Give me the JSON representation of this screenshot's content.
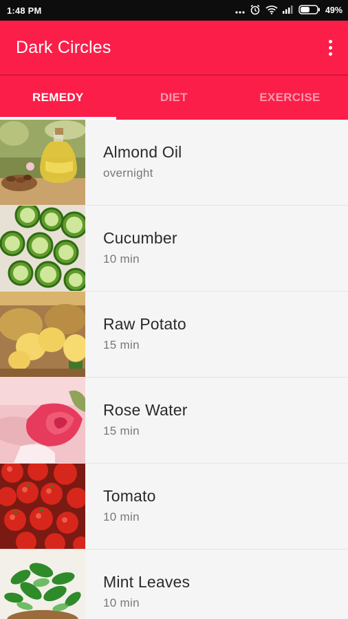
{
  "status_bar": {
    "time": "1:48 PM",
    "battery_text": "49%",
    "icons": [
      "more-dots-icon",
      "alarm-icon",
      "wifi-icon",
      "signal-icon",
      "battery-icon"
    ]
  },
  "app_bar": {
    "title": "Dark Circles",
    "menu_icon": "overflow-menu-icon",
    "color": "#fb1e49"
  },
  "tabs": [
    {
      "label": "REMEDY",
      "active": true
    },
    {
      "label": "DIET",
      "active": false
    },
    {
      "label": "EXERCISE",
      "active": false
    }
  ],
  "remedies": [
    {
      "name": "Almond Oil",
      "duration": "overnight",
      "image": "almond-oil-photo"
    },
    {
      "name": "Cucumber",
      "duration": "10 min",
      "image": "cucumber-photo"
    },
    {
      "name": "Raw Potato",
      "duration": "15 min",
      "image": "potato-photo"
    },
    {
      "name": "Rose Water",
      "duration": "15 min",
      "image": "rose-photo"
    },
    {
      "name": "Tomato",
      "duration": "10 min",
      "image": "tomato-photo"
    },
    {
      "name": "Mint Leaves",
      "duration": "10 min",
      "image": "mint-photo"
    }
  ]
}
